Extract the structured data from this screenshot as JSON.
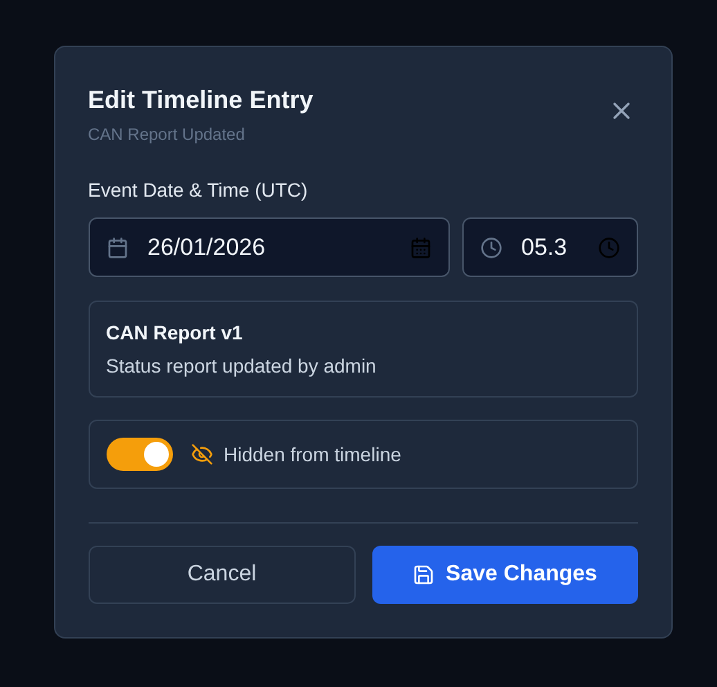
{
  "dialog": {
    "title": "Edit Timeline Entry",
    "subtitle": "CAN Report Updated"
  },
  "datetime": {
    "label": "Event Date & Time (UTC)",
    "date": "26/01/2026",
    "time": "05.3"
  },
  "entry": {
    "title": "CAN Report v1",
    "description": "Status report updated by admin"
  },
  "visibility": {
    "on": true,
    "label": "Hidden from timeline"
  },
  "buttons": [
    {
      "kind": "secondary",
      "label": "Cancel"
    },
    {
      "kind": "primary",
      "label": "Save Changes"
    }
  ]
}
